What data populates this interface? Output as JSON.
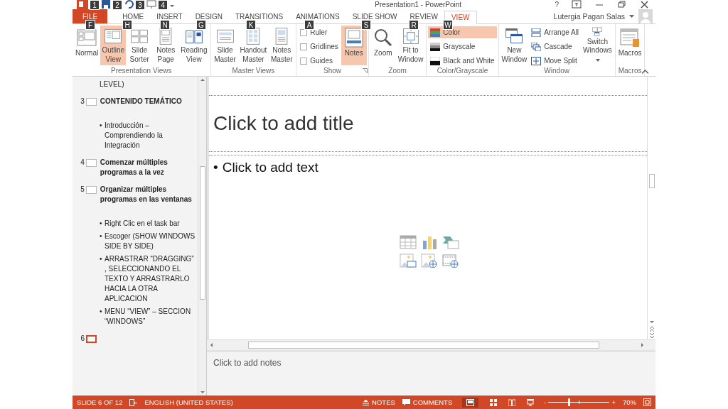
{
  "title_bar": {
    "title": "Presentation1 - PowerPoint",
    "help": "?"
  },
  "key_tips": [
    {
      "label": "1"
    },
    {
      "label": "2"
    },
    {
      "label": "3"
    },
    {
      "label": "4"
    },
    {
      "label": "F"
    },
    {
      "label": "H"
    },
    {
      "label": "N"
    },
    {
      "label": "G"
    },
    {
      "label": "K"
    },
    {
      "label": "A"
    },
    {
      "label": "S"
    },
    {
      "label": "R"
    },
    {
      "label": "W"
    }
  ],
  "tabs": [
    {
      "label": "FILE",
      "kind": "file",
      "selected": false
    },
    {
      "label": "HOME",
      "kind": "tab",
      "selected": false
    },
    {
      "label": "INSERT",
      "kind": "tab",
      "selected": false
    },
    {
      "label": "DESIGN",
      "kind": "tab",
      "selected": false
    },
    {
      "label": "TRANSITIONS",
      "kind": "tab",
      "selected": false
    },
    {
      "label": "ANIMATIONS",
      "kind": "tab",
      "selected": false
    },
    {
      "label": "SLIDE SHOW",
      "kind": "tab",
      "selected": false
    },
    {
      "label": "REVIEW",
      "kind": "tab",
      "selected": false
    },
    {
      "label": "VIEW",
      "kind": "tab",
      "selected": true
    }
  ],
  "user": {
    "name": "Lutergia Pagan Salas"
  },
  "ribbon": {
    "groups": [
      {
        "label": "Presentation Views",
        "items": [
          {
            "kind": "large",
            "label": "Normal",
            "selected": false
          },
          {
            "kind": "large",
            "label": "Outline View",
            "selected": true
          },
          {
            "kind": "large",
            "label": "Slide Sorter",
            "selected": false
          },
          {
            "kind": "large",
            "label": "Notes Page",
            "selected": false
          },
          {
            "kind": "large",
            "label": "Reading View",
            "selected": false
          }
        ]
      },
      {
        "label": "Master Views",
        "items": [
          {
            "kind": "large",
            "label": "Slide Master",
            "selected": false
          },
          {
            "kind": "large",
            "label": "Handout Master",
            "selected": false
          },
          {
            "kind": "large",
            "label": "Notes Master",
            "selected": false
          }
        ]
      },
      {
        "label": "Show",
        "launcher": true,
        "items": [
          {
            "kind": "check",
            "label": "Ruler",
            "checked": false
          },
          {
            "kind": "check",
            "label": "Gridlines",
            "checked": false
          },
          {
            "kind": "check",
            "label": "Guides",
            "checked": false
          },
          {
            "kind": "large",
            "label": "Notes",
            "selected": true
          }
        ]
      },
      {
        "label": "Zoom",
        "items": [
          {
            "kind": "large",
            "label": "Zoom",
            "selected": false
          },
          {
            "kind": "large",
            "label": "Fit to Window",
            "selected": false
          }
        ]
      },
      {
        "label": "Color/Grayscale",
        "items": [
          {
            "kind": "small",
            "label": "Color",
            "selected": true
          },
          {
            "kind": "small",
            "label": "Grayscale",
            "selected": false
          },
          {
            "kind": "small",
            "label": "Black and White",
            "selected": false
          }
        ]
      },
      {
        "label": "Window",
        "items": [
          {
            "kind": "large",
            "label": "New Window",
            "selected": false
          },
          {
            "kind": "small",
            "label": "Arrange All",
            "selected": false
          },
          {
            "kind": "small",
            "label": "Cascade",
            "selected": false
          },
          {
            "kind": "small",
            "label": "Move Split",
            "selected": false
          },
          {
            "kind": "dropdown",
            "label": "Switch Windows",
            "selected": false
          }
        ]
      },
      {
        "label": "Macros",
        "items": [
          {
            "kind": "large",
            "label": "Macros",
            "selected": false
          }
        ]
      }
    ]
  },
  "outline": [
    {
      "kind": "continued",
      "text": "LEVEL)"
    },
    {
      "kind": "slide",
      "number": "3",
      "title": "CONTENIDO TEMÁTICO",
      "selected": false,
      "bullets": [
        {
          "marker": "•",
          "text": "Introducción – Comprendiendo la Integración"
        }
      ]
    },
    {
      "kind": "slide",
      "number": "4",
      "title": "Comenzar múltiples programas a la vez",
      "selected": false
    },
    {
      "kind": "slide",
      "number": "5",
      "title": "Organizar múltiples programas en las ventanas",
      "selected": false,
      "bullets": [
        {
          "marker": "•",
          "text": "Right Clic  en el task bar"
        },
        {
          "marker": "•",
          "text": "Escoger (SHOW WINDOWS SIDE BY SIDE)"
        },
        {
          "marker": "•",
          "text": "ARRASTRAR “DRAGGING” , SELECCIONANDO EL TEXTO Y ARRASTRARLO HACIA LA OTRA APLICACION"
        },
        {
          "marker": "•",
          "text": "MENU “VIEW” – SECCION “WINDOWS”"
        }
      ]
    },
    {
      "kind": "slide",
      "number": "6",
      "selected": true
    }
  ],
  "slide": {
    "title_placeholder": "Click to add title",
    "body_marker": "•",
    "body_placeholder": "Click to add text"
  },
  "notes": {
    "placeholder": "Click to add notes"
  },
  "status_bar": {
    "slide": "SLIDE 6 OF 12",
    "language": "ENGLISH (UNITED STATES)",
    "notes": "NOTES",
    "comments": "COMMENTS",
    "zoom_out": "-",
    "zoom_in": "+",
    "zoom": "70%",
    "zoom_slider": {
      "level": 0.33
    }
  }
}
